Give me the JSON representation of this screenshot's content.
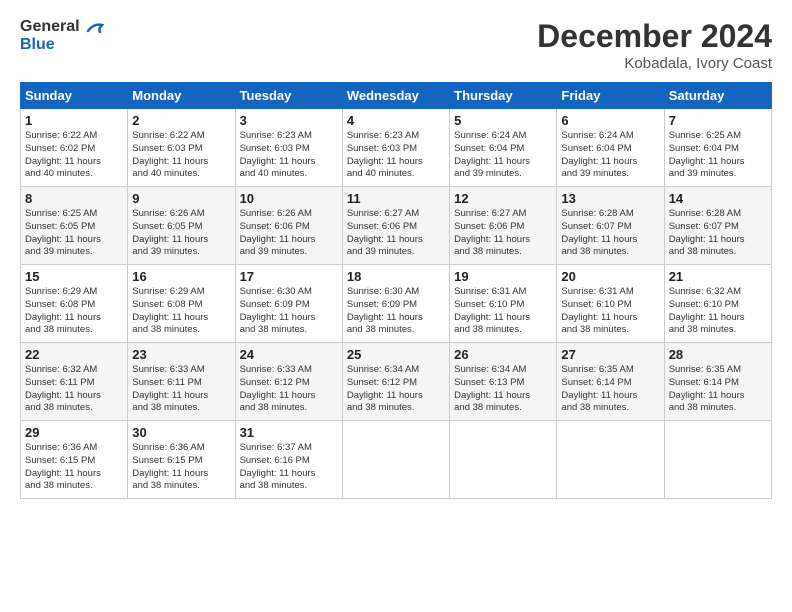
{
  "header": {
    "logo_line1": "General",
    "logo_line2": "Blue",
    "title": "December 2024",
    "subtitle": "Kobadala, Ivory Coast"
  },
  "days_of_week": [
    "Sunday",
    "Monday",
    "Tuesday",
    "Wednesday",
    "Thursday",
    "Friday",
    "Saturday"
  ],
  "weeks": [
    [
      {
        "day": "1",
        "info": "Sunrise: 6:22 AM\nSunset: 6:02 PM\nDaylight: 11 hours\nand 40 minutes."
      },
      {
        "day": "2",
        "info": "Sunrise: 6:22 AM\nSunset: 6:03 PM\nDaylight: 11 hours\nand 40 minutes."
      },
      {
        "day": "3",
        "info": "Sunrise: 6:23 AM\nSunset: 6:03 PM\nDaylight: 11 hours\nand 40 minutes."
      },
      {
        "day": "4",
        "info": "Sunrise: 6:23 AM\nSunset: 6:03 PM\nDaylight: 11 hours\nand 40 minutes."
      },
      {
        "day": "5",
        "info": "Sunrise: 6:24 AM\nSunset: 6:04 PM\nDaylight: 11 hours\nand 39 minutes."
      },
      {
        "day": "6",
        "info": "Sunrise: 6:24 AM\nSunset: 6:04 PM\nDaylight: 11 hours\nand 39 minutes."
      },
      {
        "day": "7",
        "info": "Sunrise: 6:25 AM\nSunset: 6:04 PM\nDaylight: 11 hours\nand 39 minutes."
      }
    ],
    [
      {
        "day": "8",
        "info": "Sunrise: 6:25 AM\nSunset: 6:05 PM\nDaylight: 11 hours\nand 39 minutes."
      },
      {
        "day": "9",
        "info": "Sunrise: 6:26 AM\nSunset: 6:05 PM\nDaylight: 11 hours\nand 39 minutes."
      },
      {
        "day": "10",
        "info": "Sunrise: 6:26 AM\nSunset: 6:06 PM\nDaylight: 11 hours\nand 39 minutes."
      },
      {
        "day": "11",
        "info": "Sunrise: 6:27 AM\nSunset: 6:06 PM\nDaylight: 11 hours\nand 39 minutes."
      },
      {
        "day": "12",
        "info": "Sunrise: 6:27 AM\nSunset: 6:06 PM\nDaylight: 11 hours\nand 38 minutes."
      },
      {
        "day": "13",
        "info": "Sunrise: 6:28 AM\nSunset: 6:07 PM\nDaylight: 11 hours\nand 38 minutes."
      },
      {
        "day": "14",
        "info": "Sunrise: 6:28 AM\nSunset: 6:07 PM\nDaylight: 11 hours\nand 38 minutes."
      }
    ],
    [
      {
        "day": "15",
        "info": "Sunrise: 6:29 AM\nSunset: 6:08 PM\nDaylight: 11 hours\nand 38 minutes."
      },
      {
        "day": "16",
        "info": "Sunrise: 6:29 AM\nSunset: 6:08 PM\nDaylight: 11 hours\nand 38 minutes."
      },
      {
        "day": "17",
        "info": "Sunrise: 6:30 AM\nSunset: 6:09 PM\nDaylight: 11 hours\nand 38 minutes."
      },
      {
        "day": "18",
        "info": "Sunrise: 6:30 AM\nSunset: 6:09 PM\nDaylight: 11 hours\nand 38 minutes."
      },
      {
        "day": "19",
        "info": "Sunrise: 6:31 AM\nSunset: 6:10 PM\nDaylight: 11 hours\nand 38 minutes."
      },
      {
        "day": "20",
        "info": "Sunrise: 6:31 AM\nSunset: 6:10 PM\nDaylight: 11 hours\nand 38 minutes."
      },
      {
        "day": "21",
        "info": "Sunrise: 6:32 AM\nSunset: 6:10 PM\nDaylight: 11 hours\nand 38 minutes."
      }
    ],
    [
      {
        "day": "22",
        "info": "Sunrise: 6:32 AM\nSunset: 6:11 PM\nDaylight: 11 hours\nand 38 minutes."
      },
      {
        "day": "23",
        "info": "Sunrise: 6:33 AM\nSunset: 6:11 PM\nDaylight: 11 hours\nand 38 minutes."
      },
      {
        "day": "24",
        "info": "Sunrise: 6:33 AM\nSunset: 6:12 PM\nDaylight: 11 hours\nand 38 minutes."
      },
      {
        "day": "25",
        "info": "Sunrise: 6:34 AM\nSunset: 6:12 PM\nDaylight: 11 hours\nand 38 minutes."
      },
      {
        "day": "26",
        "info": "Sunrise: 6:34 AM\nSunset: 6:13 PM\nDaylight: 11 hours\nand 38 minutes."
      },
      {
        "day": "27",
        "info": "Sunrise: 6:35 AM\nSunset: 6:14 PM\nDaylight: 11 hours\nand 38 minutes."
      },
      {
        "day": "28",
        "info": "Sunrise: 6:35 AM\nSunset: 6:14 PM\nDaylight: 11 hours\nand 38 minutes."
      }
    ],
    [
      {
        "day": "29",
        "info": "Sunrise: 6:36 AM\nSunset: 6:15 PM\nDaylight: 11 hours\nand 38 minutes."
      },
      {
        "day": "30",
        "info": "Sunrise: 6:36 AM\nSunset: 6:15 PM\nDaylight: 11 hours\nand 38 minutes."
      },
      {
        "day": "31",
        "info": "Sunrise: 6:37 AM\nSunset: 6:16 PM\nDaylight: 11 hours\nand 38 minutes."
      },
      {
        "day": "",
        "info": ""
      },
      {
        "day": "",
        "info": ""
      },
      {
        "day": "",
        "info": ""
      },
      {
        "day": "",
        "info": ""
      }
    ]
  ]
}
